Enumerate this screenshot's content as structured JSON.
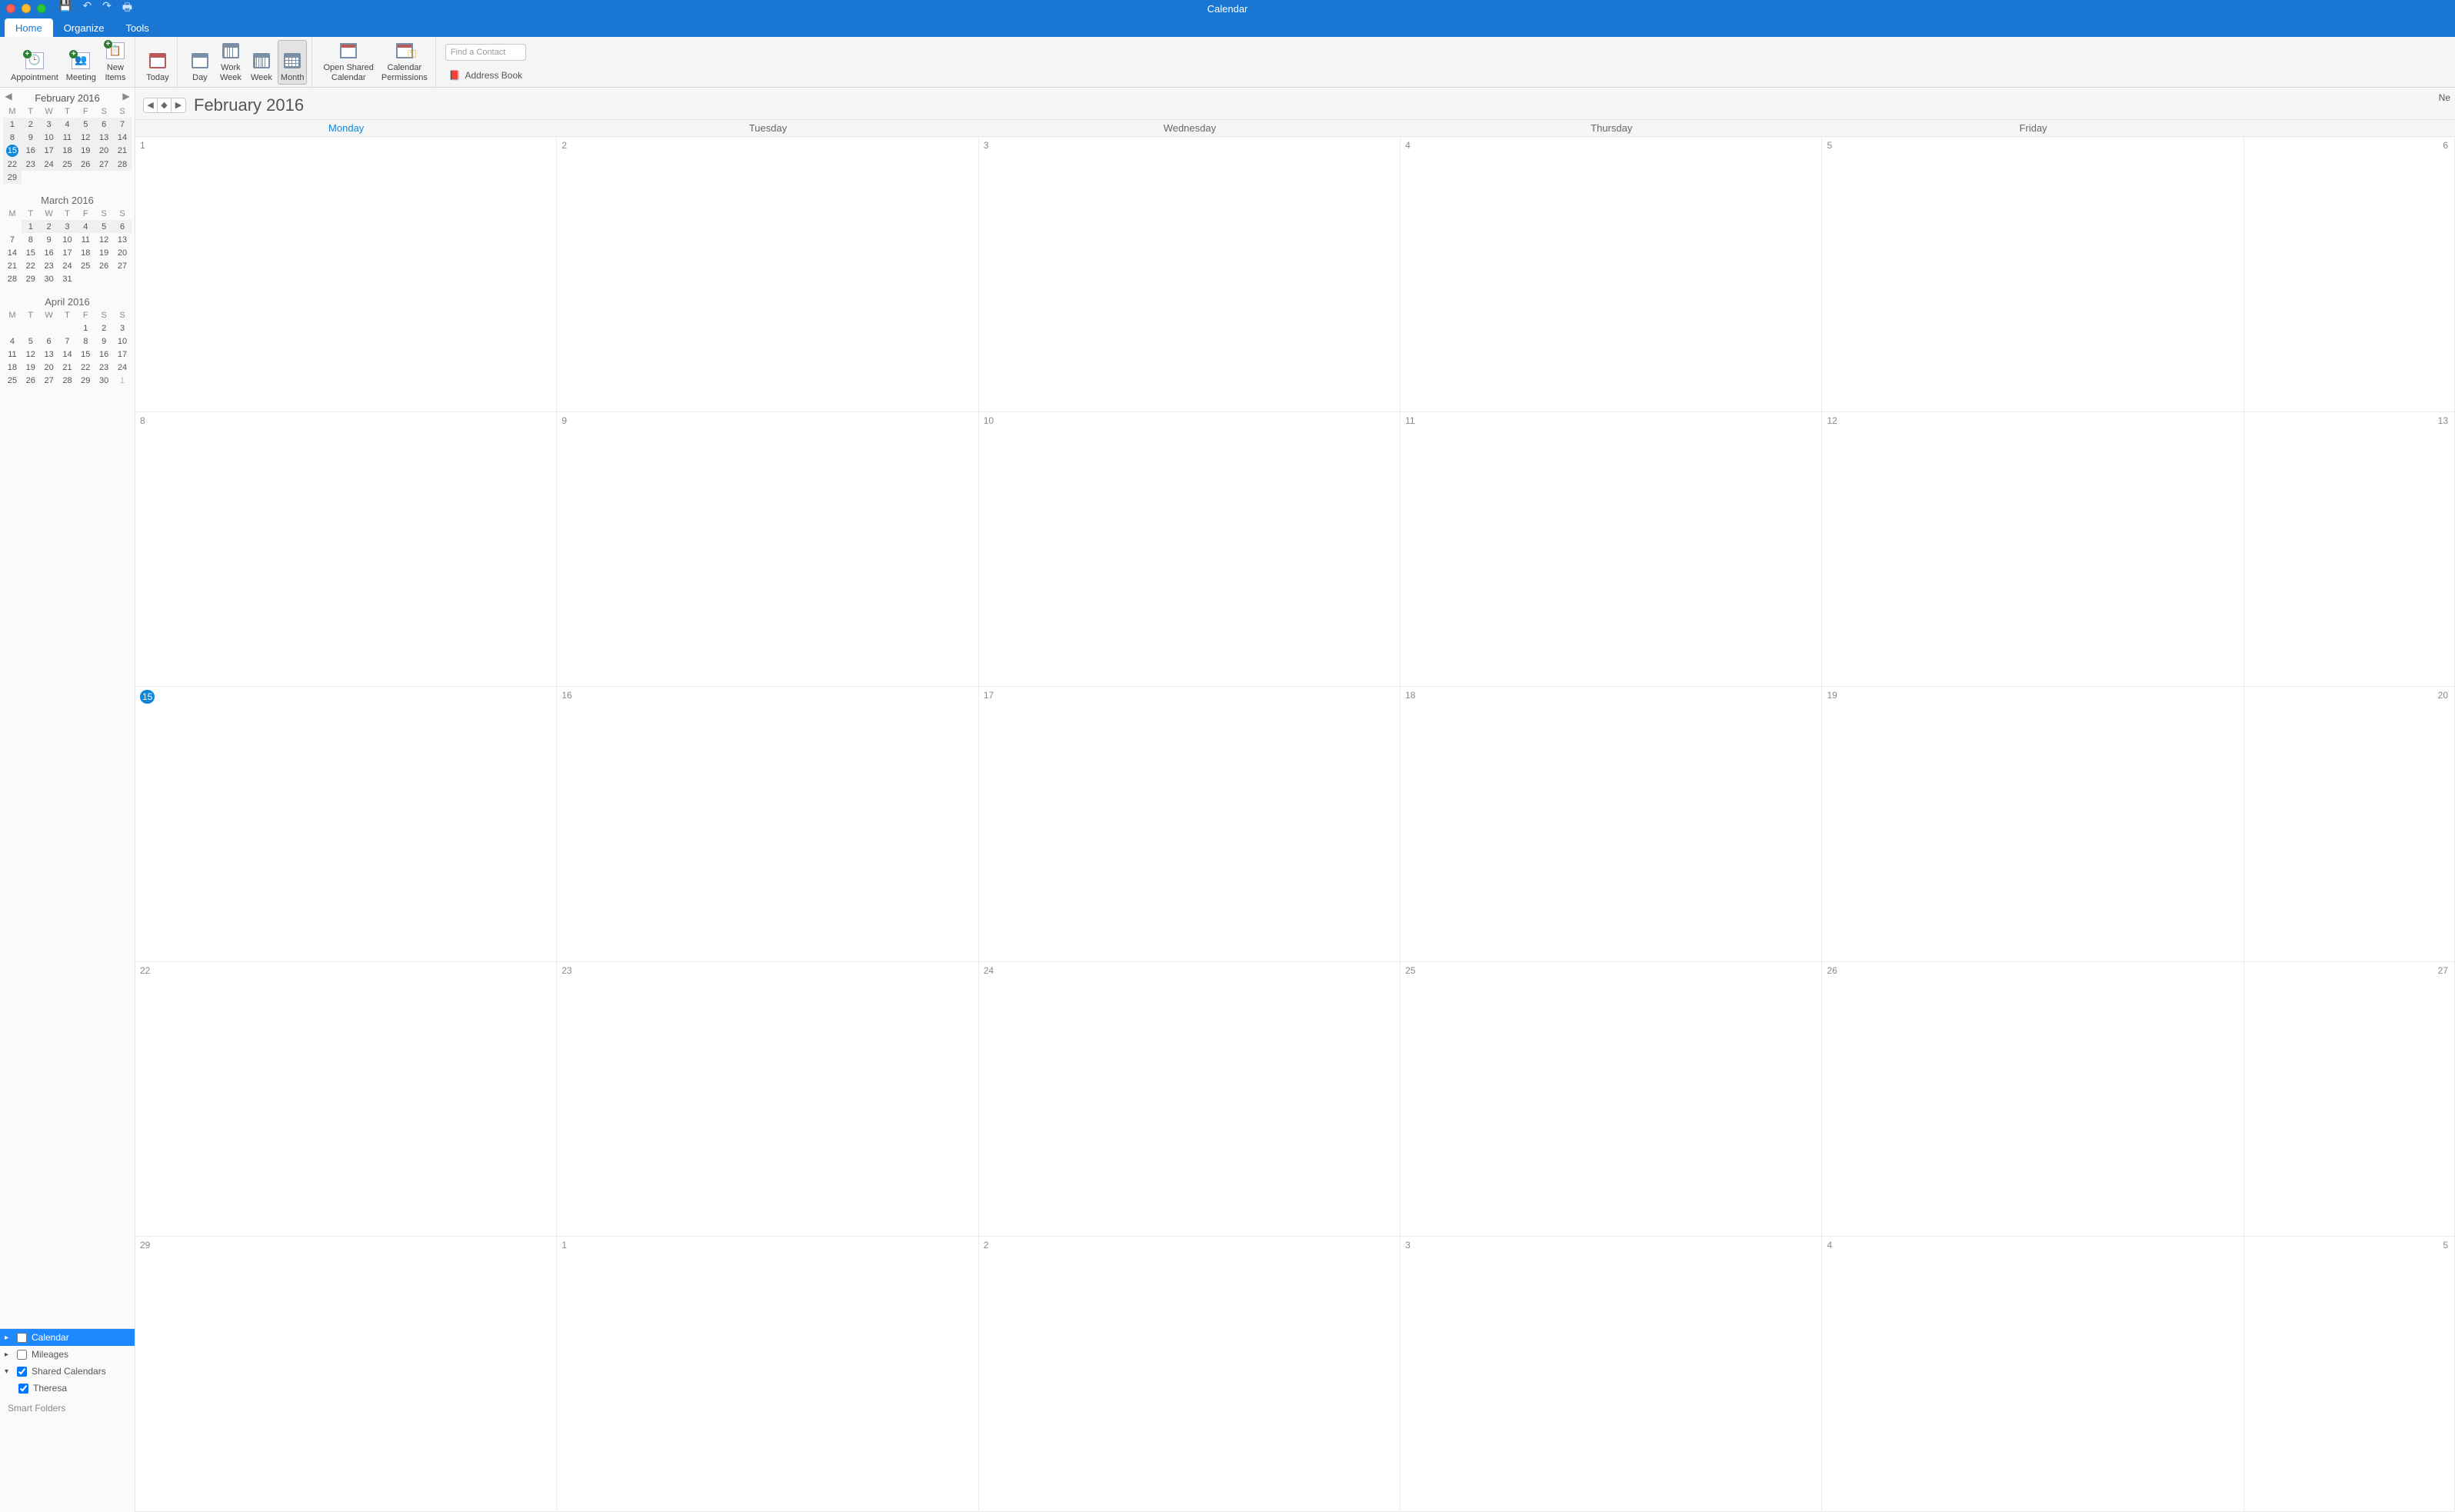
{
  "window": {
    "title": "Calendar"
  },
  "qat": {
    "save": "save-icon",
    "undo": "undo-icon",
    "redo": "redo-icon",
    "print": "print-icon"
  },
  "tabs": [
    {
      "label": "Home",
      "active": true
    },
    {
      "label": "Organize",
      "active": false
    },
    {
      "label": "Tools",
      "active": false
    }
  ],
  "ribbon": {
    "appointment": "Appointment",
    "meeting": "Meeting",
    "new_items": "New\nItems",
    "today": "Today",
    "day": "Day",
    "work_week": "Work\nWeek",
    "week": "Week",
    "month": "Month",
    "open_shared": "Open Shared\nCalendar",
    "cal_perms": "Calendar\nPermissions",
    "find_contact_placeholder": "Find a Contact",
    "address_book": "Address Book"
  },
  "sidebar": {
    "nav_month": "February 2016",
    "dow": [
      "M",
      "T",
      "W",
      "T",
      "F",
      "S",
      "S"
    ],
    "months": [
      {
        "title": "February 2016",
        "weeks": [
          [
            {
              "d": "1",
              "s": true
            },
            {
              "d": "2",
              "s": true
            },
            {
              "d": "3",
              "s": true
            },
            {
              "d": "4",
              "s": true
            },
            {
              "d": "5",
              "s": true
            },
            {
              "d": "6",
              "s": true
            },
            {
              "d": "7",
              "s": true
            }
          ],
          [
            {
              "d": "8",
              "s": true
            },
            {
              "d": "9",
              "s": true
            },
            {
              "d": "10",
              "s": true
            },
            {
              "d": "11",
              "s": true
            },
            {
              "d": "12",
              "s": true
            },
            {
              "d": "13",
              "s": true
            },
            {
              "d": "14",
              "s": true
            }
          ],
          [
            {
              "d": "15",
              "s": true,
              "today": true
            },
            {
              "d": "16",
              "s": true
            },
            {
              "d": "17",
              "s": true
            },
            {
              "d": "18",
              "s": true
            },
            {
              "d": "19",
              "s": true
            },
            {
              "d": "20",
              "s": true
            },
            {
              "d": "21",
              "s": true
            }
          ],
          [
            {
              "d": "22",
              "s": true
            },
            {
              "d": "23",
              "s": true
            },
            {
              "d": "24",
              "s": true
            },
            {
              "d": "25",
              "s": true
            },
            {
              "d": "26",
              "s": true
            },
            {
              "d": "27",
              "s": true
            },
            {
              "d": "28",
              "s": true
            }
          ],
          [
            {
              "d": "29",
              "s": true
            },
            {
              "d": ""
            },
            {
              "d": ""
            },
            {
              "d": ""
            },
            {
              "d": ""
            },
            {
              "d": ""
            },
            {
              "d": ""
            }
          ]
        ]
      },
      {
        "title": "March 2016",
        "weeks": [
          [
            {
              "d": ""
            },
            {
              "d": "1",
              "s": true
            },
            {
              "d": "2",
              "s": true
            },
            {
              "d": "3",
              "s": true
            },
            {
              "d": "4",
              "s": true
            },
            {
              "d": "5",
              "s": true
            },
            {
              "d": "6",
              "s": true
            }
          ],
          [
            {
              "d": "7"
            },
            {
              "d": "8"
            },
            {
              "d": "9"
            },
            {
              "d": "10"
            },
            {
              "d": "11"
            },
            {
              "d": "12"
            },
            {
              "d": "13"
            }
          ],
          [
            {
              "d": "14"
            },
            {
              "d": "15"
            },
            {
              "d": "16"
            },
            {
              "d": "17"
            },
            {
              "d": "18"
            },
            {
              "d": "19"
            },
            {
              "d": "20"
            }
          ],
          [
            {
              "d": "21"
            },
            {
              "d": "22"
            },
            {
              "d": "23"
            },
            {
              "d": "24"
            },
            {
              "d": "25"
            },
            {
              "d": "26"
            },
            {
              "d": "27"
            }
          ],
          [
            {
              "d": "28"
            },
            {
              "d": "29"
            },
            {
              "d": "30"
            },
            {
              "d": "31"
            },
            {
              "d": ""
            },
            {
              "d": ""
            },
            {
              "d": ""
            }
          ]
        ]
      },
      {
        "title": "April 2016",
        "weeks": [
          [
            {
              "d": ""
            },
            {
              "d": ""
            },
            {
              "d": ""
            },
            {
              "d": ""
            },
            {
              "d": "1"
            },
            {
              "d": "2"
            },
            {
              "d": "3"
            }
          ],
          [
            {
              "d": "4"
            },
            {
              "d": "5"
            },
            {
              "d": "6"
            },
            {
              "d": "7"
            },
            {
              "d": "8"
            },
            {
              "d": "9"
            },
            {
              "d": "10"
            }
          ],
          [
            {
              "d": "11"
            },
            {
              "d": "12"
            },
            {
              "d": "13"
            },
            {
              "d": "14"
            },
            {
              "d": "15"
            },
            {
              "d": "16"
            },
            {
              "d": "17"
            }
          ],
          [
            {
              "d": "18"
            },
            {
              "d": "19"
            },
            {
              "d": "20"
            },
            {
              "d": "21"
            },
            {
              "d": "22"
            },
            {
              "d": "23"
            },
            {
              "d": "24"
            }
          ],
          [
            {
              "d": "25"
            },
            {
              "d": "26"
            },
            {
              "d": "27"
            },
            {
              "d": "28"
            },
            {
              "d": "29"
            },
            {
              "d": "30"
            },
            {
              "d": "1",
              "other": true
            }
          ]
        ]
      }
    ],
    "calendars": {
      "calendar": "Calendar",
      "mileages": "Mileages",
      "shared": "Shared Calendars",
      "theresa": "Theresa",
      "smart": "Smart Folders"
    }
  },
  "main": {
    "title": "February 2016",
    "corner": "Ne",
    "dow": [
      "Monday",
      "Tuesday",
      "Wednesday",
      "Thursday",
      "Friday",
      ""
    ],
    "weeks": [
      [
        {
          "d": "1"
        },
        {
          "d": "2"
        },
        {
          "d": "3"
        },
        {
          "d": "4"
        },
        {
          "d": "5"
        },
        {
          "d": "6",
          "right": true
        }
      ],
      [
        {
          "d": "8"
        },
        {
          "d": "9"
        },
        {
          "d": "10"
        },
        {
          "d": "11"
        },
        {
          "d": "12"
        },
        {
          "d": "13",
          "right": true
        }
      ],
      [
        {
          "d": "15",
          "today": true
        },
        {
          "d": "16"
        },
        {
          "d": "17"
        },
        {
          "d": "18"
        },
        {
          "d": "19"
        },
        {
          "d": "20",
          "right": true
        }
      ],
      [
        {
          "d": "22"
        },
        {
          "d": "23"
        },
        {
          "d": "24"
        },
        {
          "d": "25"
        },
        {
          "d": "26"
        },
        {
          "d": "27",
          "right": true
        }
      ],
      [
        {
          "d": "29"
        },
        {
          "d": "1"
        },
        {
          "d": "2"
        },
        {
          "d": "3"
        },
        {
          "d": "4"
        },
        {
          "d": "5",
          "right": true
        }
      ]
    ]
  }
}
